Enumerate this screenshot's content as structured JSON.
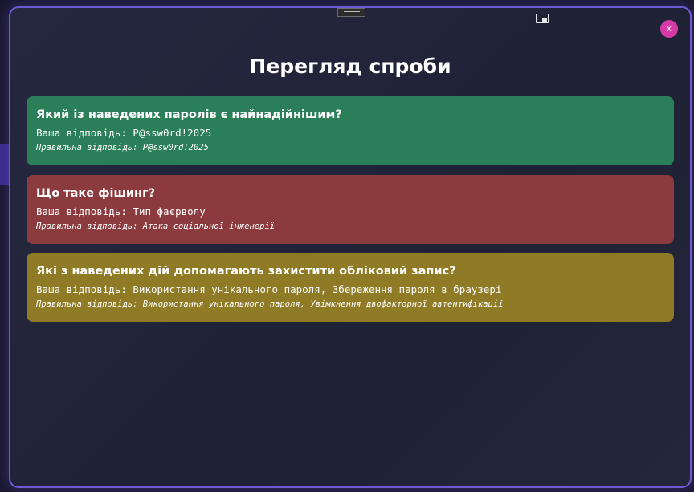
{
  "modal": {
    "title": "Перегляд спроби",
    "close_label": "x"
  },
  "labels": {
    "your_answer": "Ваша відповідь: ",
    "correct_answer": "Правильна відповідь: "
  },
  "colors": {
    "correct": "#2a7f58",
    "wrong": "#8b3b3d",
    "partial": "#8f7a25",
    "close_button": "#d63aa6",
    "border": "#6c5bd4"
  },
  "questions": [
    {
      "status": "correct",
      "question": "Який із наведених паролів є найнадійнішим?",
      "your_answer": "P@ssw0rd!2025",
      "correct_answer": "P@ssw0rd!2025"
    },
    {
      "status": "wrong",
      "question": "Що таке фішинг?",
      "your_answer": "Тип фаєрволу",
      "correct_answer": "Атака соціальної інженерії"
    },
    {
      "status": "partial",
      "question": "Які з наведених дій допомагають захистити обліковий запис?",
      "your_answer": "Використання унікального пароля, Збереження пароля в браузері",
      "correct_answer": "Використання унікального пароля, Увімкнення двофакторної автентифікації"
    }
  ]
}
